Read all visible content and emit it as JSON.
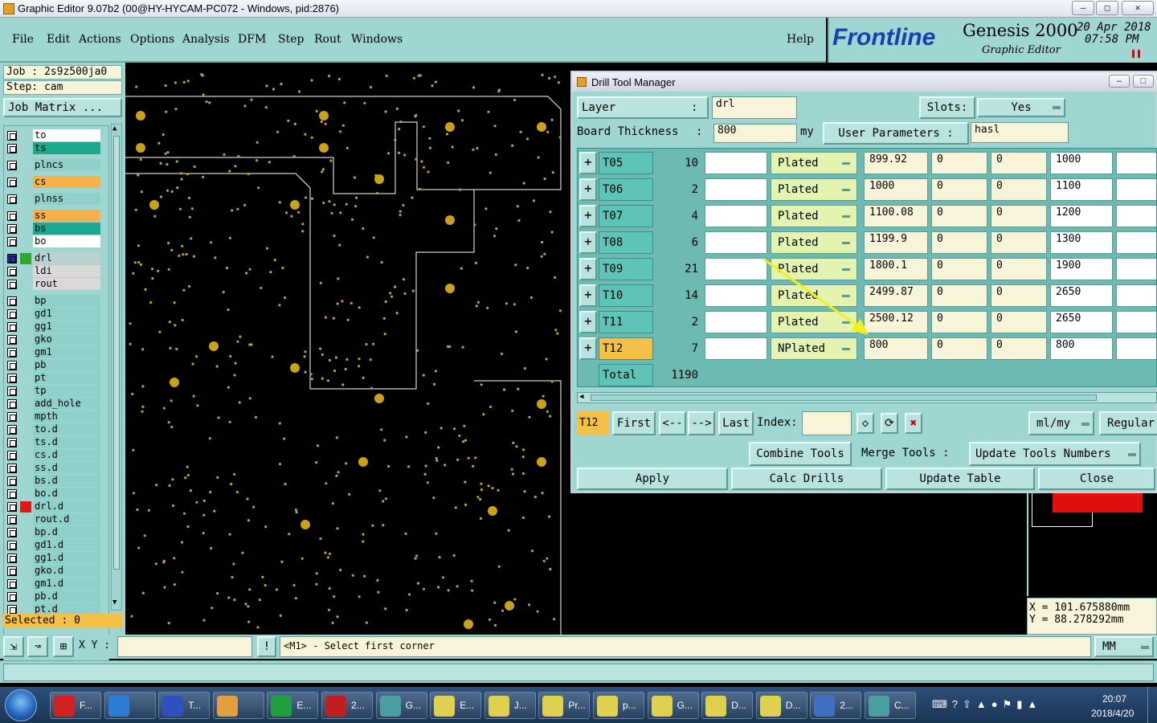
{
  "window": {
    "title": "Graphic Editor 9.07b2 (00@HY-HYCAM-PC072 - Windows, pid:2876)"
  },
  "menu": [
    "File",
    "Edit",
    "Actions",
    "Options",
    "Analysis",
    "DFM",
    "Step",
    "Rout",
    "Windows"
  ],
  "help": "Help",
  "brand": {
    "logo": "Frontline",
    "product": "Genesis 2000",
    "sub": "Graphic Editor",
    "date": "20 Apr 2018",
    "time": "07:58 PM"
  },
  "job": {
    "job": "Job : 2s9z500ja0",
    "step": "Step: cam",
    "matrix": "Job Matrix ..."
  },
  "layers": [
    "to",
    "ts",
    "plncs",
    "cs",
    "plnss",
    "ss",
    "bs",
    "bo",
    "drl",
    "ldi",
    "rout",
    "bp",
    "gd1",
    "gg1",
    "gko",
    "gm1",
    "pb",
    "pt",
    "tp",
    "add_hole",
    "mpth",
    "to.d",
    "ts.d",
    "cs.d",
    "ss.d",
    "bs.d",
    "bo.d",
    "drl.d",
    "rout.d",
    "bp.d",
    "gd1.d",
    "gg1.d",
    "gko.d",
    "gm1.d",
    "pb.d",
    "pt.d"
  ],
  "layer_colors": {
    "to": "#ffffff",
    "ts": "#1ea88e",
    "cs": "#f5b14c",
    "ss": "#f5b14c",
    "bs": "#1ea88e",
    "bo": "#ffffff",
    "drl": "#b9d3d0",
    "ldi": "#d9d9d9",
    "rout": "#d9d9d9"
  },
  "selected": "Selected : 0",
  "dialog": {
    "title": "Drill Tool Manager",
    "layer_label": "Layer",
    "layer_sep": ":",
    "layer_value": "drl",
    "slots_label": "Slots:",
    "slots_value": "Yes",
    "thickness_label": "Board Thickness",
    "thickness_sep": ":",
    "thickness_value": "800",
    "thickness_unit": "my",
    "user_params_label": "User Parameters :",
    "user_params_value": "hasl",
    "tools": [
      {
        "name": "T05",
        "count": "10",
        "type": "Plated",
        "size": "899.92",
        "a": "0",
        "b": "0",
        "finish": "1000"
      },
      {
        "name": "T06",
        "count": "2",
        "type": "Plated",
        "size": "1000",
        "a": "0",
        "b": "0",
        "finish": "1100"
      },
      {
        "name": "T07",
        "count": "4",
        "type": "Plated",
        "size": "1100.08",
        "a": "0",
        "b": "0",
        "finish": "1200"
      },
      {
        "name": "T08",
        "count": "6",
        "type": "Plated",
        "size": "1199.9",
        "a": "0",
        "b": "0",
        "finish": "1300"
      },
      {
        "name": "T09",
        "count": "21",
        "type": "Plated",
        "size": "1800.1",
        "a": "0",
        "b": "0",
        "finish": "1900"
      },
      {
        "name": "T10",
        "count": "14",
        "type": "Plated",
        "size": "2499.87",
        "a": "0",
        "b": "0",
        "finish": "2650"
      },
      {
        "name": "T11",
        "count": "2",
        "type": "Plated",
        "size": "2500.12",
        "a": "0",
        "b": "0",
        "finish": "2650"
      },
      {
        "name": "T12",
        "count": "7",
        "type": "NPlated",
        "size": "800",
        "a": "0",
        "b": "0",
        "finish": "800"
      }
    ],
    "total_label": "Total",
    "total_value": "1190",
    "current_tool": "T12",
    "nav": {
      "first": "First",
      "prev": "<--",
      "next": "-->",
      "last": "Last",
      "index": "Index:"
    },
    "units": "ml/my",
    "regular": "Regular",
    "combine": "Combine Tools",
    "merge": "Merge Tools :",
    "update_numbers": "Update Tools Numbers",
    "apply": "Apply",
    "calc": "Calc Drills",
    "update_table": "Update Table",
    "close": "Close"
  },
  "coords": {
    "x": "X = 101.675880mm",
    "y": "Y = 88.278292mm"
  },
  "status": {
    "xy_label": "X Y :",
    "xy_value": "",
    "prompt": "<M1> - Select first corner",
    "units": "MM"
  },
  "taskbar": {
    "items": [
      "F...",
      "",
      "T...",
      "",
      "E...",
      "2...",
      "G...",
      "E...",
      "J...",
      "Pr...",
      "p...",
      "G...",
      "D...",
      "D...",
      "2...",
      "C..."
    ],
    "clock_time": "20:07",
    "clock_date": "2018/4/20"
  }
}
